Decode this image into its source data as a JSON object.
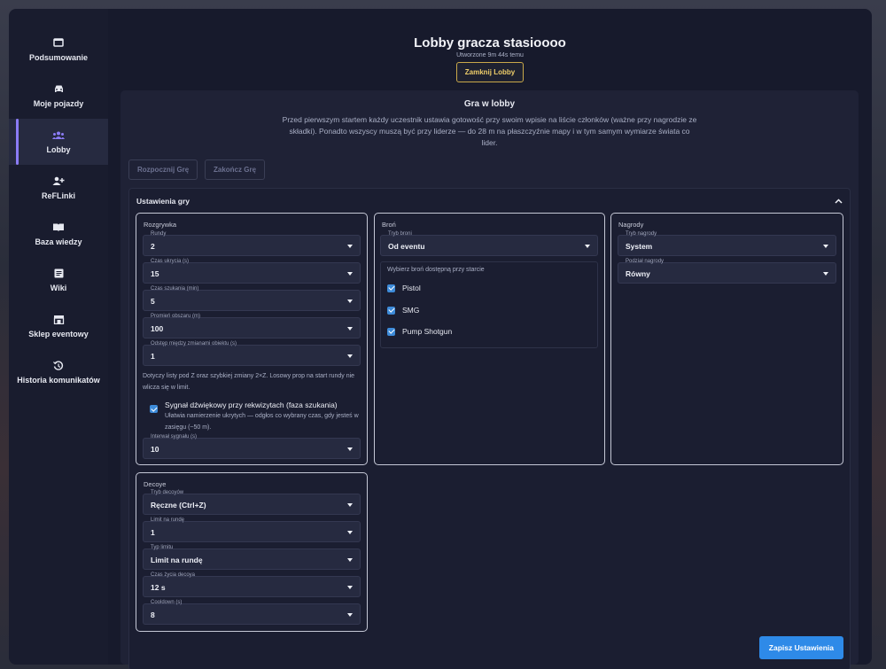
{
  "sidebar": {
    "items": [
      {
        "label": "Podsumowanie",
        "icon": "monitor-icon"
      },
      {
        "label": "Moje pojazdy",
        "icon": "car-icon"
      },
      {
        "label": "Lobby",
        "icon": "group-icon",
        "active": true
      },
      {
        "label": "ReFLinki",
        "icon": "person-add-icon"
      },
      {
        "label": "Baza wiedzy",
        "icon": "book-icon"
      },
      {
        "label": "Wiki",
        "icon": "document-icon"
      },
      {
        "label": "Sklep eventowy",
        "icon": "store-icon"
      },
      {
        "label": "Historia komunikatów",
        "icon": "history-icon"
      }
    ]
  },
  "header": {
    "title": "Lobby gracza stasioooo",
    "created": "Utworzone 9m 44s temu",
    "close_label": "Zamknij Lobby"
  },
  "game": {
    "title": "Gra w lobby",
    "description": "Przed pierwszym startem każdy uczestnik ustawia gotowość przy swoim wpisie na liście członków (ważne przy nagrodzie ze składki). Ponadto wszyscy muszą być przy liderze — do 28 m na płaszczyźnie mapy i w tym samym wymiarze świata co lider.",
    "start_label": "Rozpocznij Grę",
    "end_label": "Zakończ Grę"
  },
  "settings": {
    "title": "Ustawienia gry",
    "gameplay": {
      "title": "Rozgrywka",
      "fields": [
        {
          "label": "Rundy",
          "value": "2"
        },
        {
          "label": "Czas ukrycia (s)",
          "value": "15"
        },
        {
          "label": "Czas szukania (min)",
          "value": "5"
        },
        {
          "label": "Promień obszaru (m)",
          "value": "100"
        },
        {
          "label": "Odstęp między zmianami obiektu (s)",
          "value": "1"
        }
      ],
      "note": "Dotyczy listy pod Z oraz szybkiej zmiany 2×Z. Losowy prop na start rundy nie wlicza się w limit.",
      "sound_label": "Sygnał dźwiękowy przy rekwizytach (faza szukania)",
      "sound_desc": "Ułatwia namierzenie ukrytych — odgłos co wybrany czas, gdy jesteś w zasięgu (~50 m).",
      "interval": {
        "label": "Interwał sygnału (s)",
        "value": "10"
      }
    },
    "weapons": {
      "title": "Broń",
      "mode": {
        "label": "Tryb broni",
        "value": "Od eventu"
      },
      "pick_label": "Wybierz broń dostępną przy starcie",
      "items": [
        "Pistol",
        "SMG",
        "Pump Shotgun"
      ]
    },
    "rewards": {
      "title": "Nagrody",
      "mode": {
        "label": "Tryb nagrody",
        "value": "System"
      },
      "split": {
        "label": "Podział nagrody",
        "value": "Równy"
      }
    },
    "decoys": {
      "title": "Decoye",
      "fields": [
        {
          "label": "Tryb decoyów",
          "value": "Ręczne (Ctrl+Z)"
        },
        {
          "label": "Limit na rundę",
          "value": "1"
        },
        {
          "label": "Typ limitu",
          "value": "Limit na rundę"
        },
        {
          "label": "Czas życia decoya",
          "value": "12 s"
        },
        {
          "label": "Cooldown (s)",
          "value": "8"
        }
      ]
    },
    "save_label": "Zapisz Ustawienia"
  },
  "colors": {
    "accent": "#8b7cf6",
    "save": "#2e8ae8",
    "gold": "#c9a84a"
  }
}
